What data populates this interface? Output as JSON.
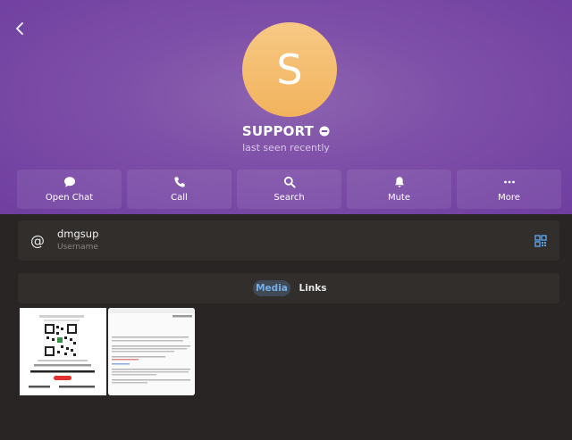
{
  "profile": {
    "initial": "S",
    "name": "SUPPORT",
    "status": "last seen recently",
    "avatar_color": "#f2b35d"
  },
  "actions": [
    {
      "label": "Open Chat",
      "icon": "chat-icon"
    },
    {
      "label": "Call",
      "icon": "phone-icon"
    },
    {
      "label": "Search",
      "icon": "search-icon"
    },
    {
      "label": "Mute",
      "icon": "bell-icon"
    },
    {
      "label": "More",
      "icon": "more-icon"
    }
  ],
  "info": {
    "username": "dmgsup",
    "username_label": "Username",
    "at_symbol": "@"
  },
  "media_tabs": {
    "media_label": "Media",
    "links_label": "Links"
  },
  "colors": {
    "header": "#7f50a8",
    "accent": "#77aee6",
    "background": "#282524"
  }
}
